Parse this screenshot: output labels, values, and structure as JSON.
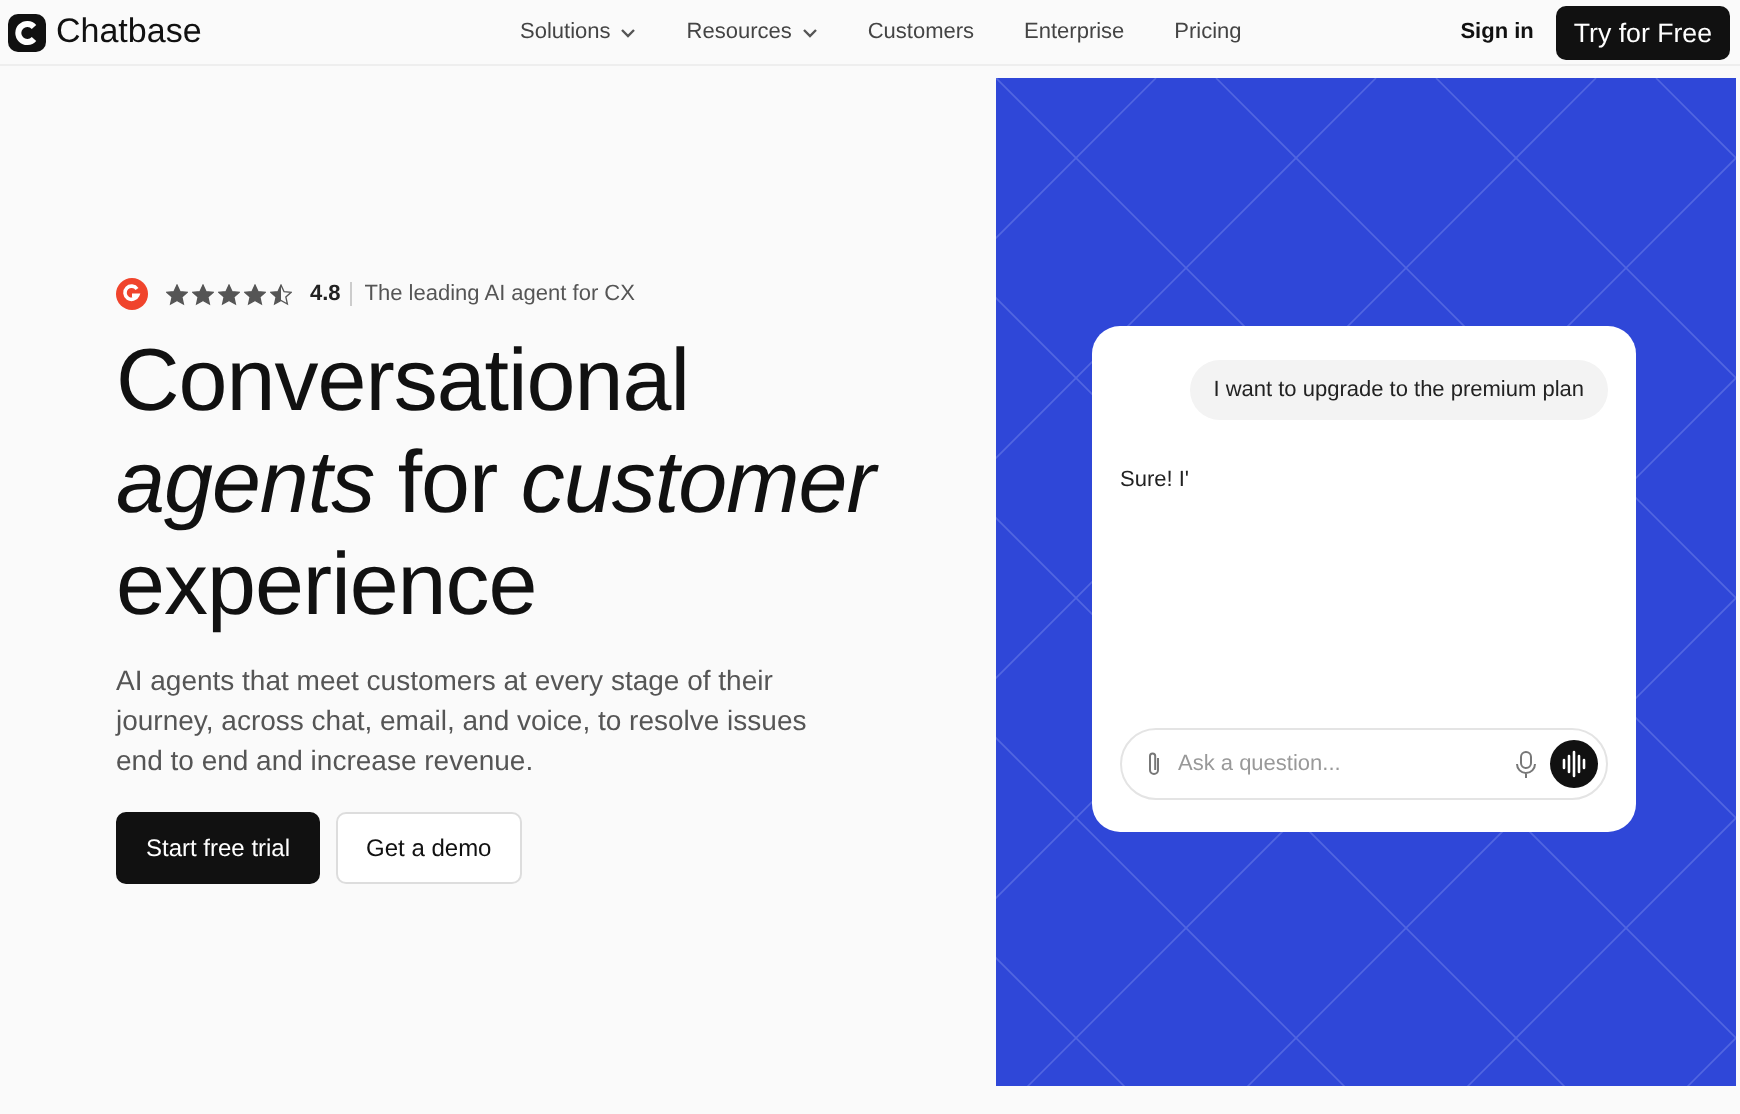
{
  "nav": {
    "logo": "Chatbase",
    "links": [
      {
        "label": "Solutions",
        "dropdown": true
      },
      {
        "label": "Resources",
        "dropdown": true
      },
      {
        "label": "Customers",
        "dropdown": false
      },
      {
        "label": "Enterprise",
        "dropdown": false
      },
      {
        "label": "Pricing",
        "dropdown": false
      }
    ],
    "sign_in": "Sign in",
    "cta": "Try for Free"
  },
  "hero": {
    "rating": {
      "stars": 4.5,
      "score": "4.8",
      "tagline": "The leading AI agent for CX"
    },
    "headline": [
      "Conversational",
      "*agents* for *customer*",
      "experience"
    ],
    "subtitle": "AI agents that meet customers at every stage of their journey, across chat, email, and voice, to resolve issues end to end and increase revenue.",
    "buttons": [
      {
        "label": "Start free trial",
        "kind": "primary"
      },
      {
        "label": "Get a demo",
        "kind": "secondary"
      }
    ]
  },
  "chat": {
    "messages": [
      {
        "kind": "user",
        "text": "I want to upgrade to the premium plan"
      },
      {
        "kind": "agent",
        "text": "Sure! I'"
      }
    ],
    "input": {
      "placeholder": "Ask a question..."
    }
  }
}
